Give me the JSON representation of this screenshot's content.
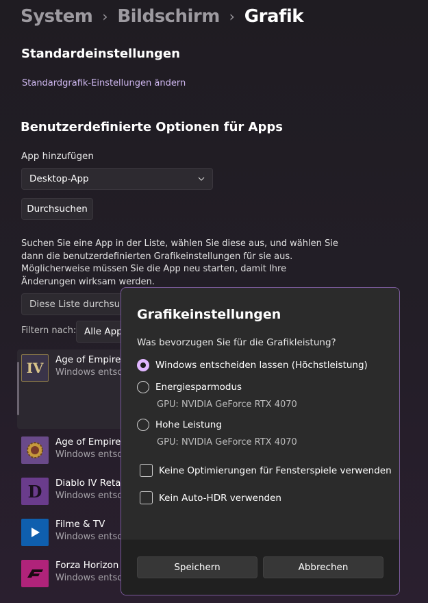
{
  "breadcrumb": {
    "items": [
      "System",
      "Bildschirm",
      "Grafik"
    ],
    "separator": "›"
  },
  "defaults": {
    "heading": "Standardeinstellungen",
    "link": "Standardgrafik-Einstellungen ändern"
  },
  "custom": {
    "heading": "Benutzerdefinierte Optionen für Apps",
    "add_app_label": "App hinzufügen",
    "app_type_selected": "Desktop-App",
    "browse_button": "Durchsuchen",
    "description": "Suchen Sie eine App in der Liste, wählen Sie diese aus, und wählen Sie dann die benutzerdefinierten Grafikeinstellungen für sie aus. Möglicherweise müssen Sie die App neu starten, damit Ihre Änderungen wirksam werden.",
    "search_placeholder": "Diese Liste durchsuchen",
    "filter_label": "Filtern nach:",
    "filter_selected": "Alle Apps"
  },
  "apps": [
    {
      "name": "Age of Empires IV",
      "sub": "Windows entscheiden lassen",
      "icon": "aoe4-icon",
      "color": "#3a3449"
    },
    {
      "name": "Age of Empires IV",
      "sub": "Windows entscheiden lassen",
      "icon": "aoe4-emblem-icon",
      "color": "#6a4a8a"
    },
    {
      "name": "Diablo IV Retail",
      "sub": "Windows entscheiden lassen",
      "icon": "diablo-icon",
      "color": "#6a3c8c"
    },
    {
      "name": "Filme & TV",
      "sub": "Windows entscheiden lassen",
      "icon": "movies-tv-icon",
      "color": "#0f5fae"
    },
    {
      "name": "Forza Horizon 5",
      "sub": "Windows entscheiden lassen",
      "icon": "forza-icon",
      "color": "#b0237a"
    }
  ],
  "dialog": {
    "title": "Grafikeinstellungen",
    "question": "Was bevorzugen Sie für die Grafikleistung?",
    "options": [
      {
        "label": "Windows entscheiden lassen (Höchstleistung)",
        "selected": true
      },
      {
        "label": "Energiesparmodus",
        "gpu": "GPU: NVIDIA GeForce RTX 4070",
        "selected": false
      },
      {
        "label": "Hohe Leistung",
        "gpu": "GPU: NVIDIA GeForce RTX 4070",
        "selected": false
      }
    ],
    "checkboxes": [
      {
        "label": "Keine Optimierungen für Fensterspiele verwenden",
        "checked": false
      },
      {
        "label": "Kein Auto-HDR verwenden",
        "checked": false
      }
    ],
    "save_button": "Speichern",
    "cancel_button": "Abbrechen"
  },
  "colors": {
    "accent": "#e0b6ff",
    "link": "#cfb8f0",
    "dialog_border": "#7a5a9b"
  }
}
